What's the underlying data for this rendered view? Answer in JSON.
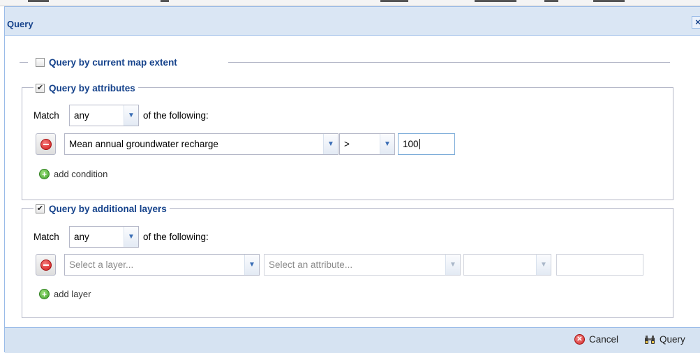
{
  "window": {
    "title": "Query",
    "close_glyph": "×"
  },
  "extent": {
    "label": "Query by current map extent",
    "checked": false
  },
  "attributes": {
    "label": "Query by attributes",
    "checked": true,
    "match_prefix": "Match",
    "match_value": "any",
    "match_suffix": "of the following:",
    "condition": {
      "field": "Mean annual groundwater recharge",
      "operator": ">",
      "value": "100"
    },
    "add_label": "add condition"
  },
  "layers": {
    "label": "Query by additional layers",
    "checked": true,
    "match_prefix": "Match",
    "match_value": "any",
    "match_suffix": "of the following:",
    "row": {
      "layer_placeholder": "Select a layer...",
      "attribute_placeholder": "Select an attribute...",
      "operator": "",
      "value": ""
    },
    "add_label": "add layer"
  },
  "footer": {
    "cancel_label": "Cancel",
    "query_label": "Query"
  },
  "colors": {
    "title": "#15428b",
    "header_bg": "#dae6f4",
    "border": "#99bbe8"
  }
}
